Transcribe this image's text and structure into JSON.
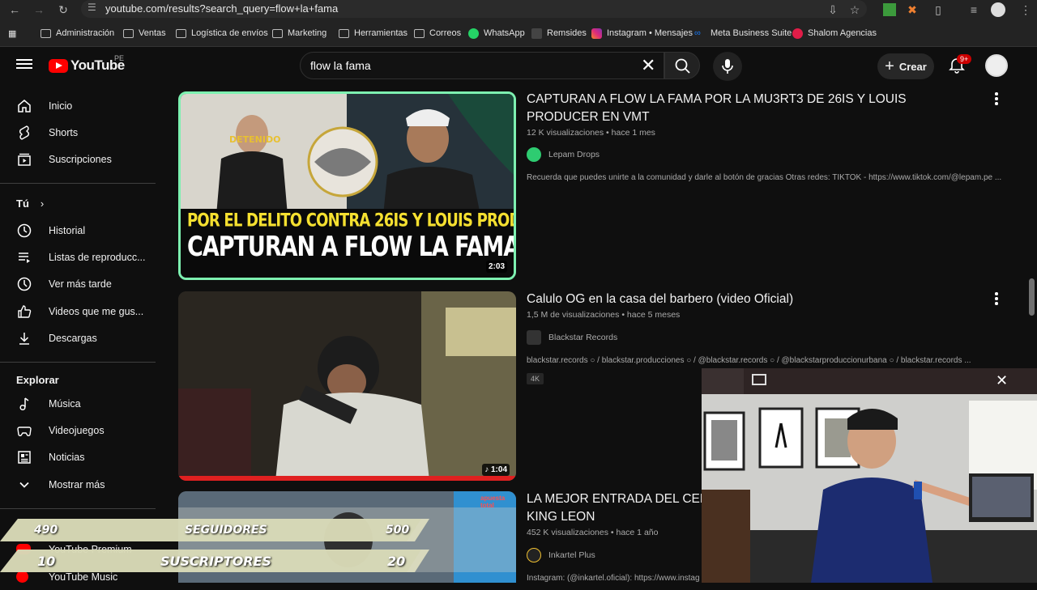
{
  "browser": {
    "url": "youtube.com/results?search_query=flow+la+fama",
    "bookmarks": [
      "Administración",
      "Ventas",
      "Logística de envíos",
      "Marketing",
      "Herramientas",
      "Correos",
      "WhatsApp",
      "Remsides",
      "Instagram • Mensajes",
      "Meta Business Suite",
      "Shalom Agencias"
    ]
  },
  "header": {
    "logo_text": "YouTube",
    "country_code": "PE",
    "search_value": "flow la fama",
    "create_label": "Crear",
    "notifications_badge": "9+"
  },
  "sidebar": {
    "main": [
      "Inicio",
      "Shorts",
      "Suscripciones"
    ],
    "you_section": "Tú",
    "you_items": [
      "Historial",
      "Listas de reproducc...",
      "Ver más tarde",
      "Videos que me gus...",
      "Descargas"
    ],
    "explore_section": "Explorar",
    "explore_items": [
      "Música",
      "Videojuegos",
      "Noticias",
      "Mostrar más"
    ],
    "more_items": [
      "YouTube Premium",
      "YouTube Music"
    ]
  },
  "results": [
    {
      "title": "CAPTURAN A FLOW LA FAMA POR LA MU3RT3 DE 26IS Y LOUIS PRODUCER EN VMT",
      "views": "12 K visualizaciones",
      "age": "hace 1 mes",
      "channel": "Lepam Drops",
      "description": "Recuerda que puedes unirte a la comunidad y darle al botón de gracias Otras redes: TIKTOK - https://www.tiktok.com/@lepam.pe ...",
      "duration": "2:03",
      "thumb_line1": "POR EL DELITO CONTRA 26IS Y LOUIS PRODUCER",
      "thumb_line2": "CAPTURAN A FLOW LA FAMA",
      "thumb_shirt": "DETENIDO"
    },
    {
      "title": "Calulo OG en la casa del barbero (video Oficial)",
      "views": "1,5 M de visualizaciones",
      "age": "hace 5 meses",
      "channel": "Blackstar Records",
      "description": "blackstar.records ○ / blackstar.producciones ○ / @blackstar.records ○ / @blackstarproduccionurbana ○ / blackstar.records ...",
      "duration": "1:04",
      "badge": "4K"
    },
    {
      "title": "LA MEJOR ENTRADA DEL CELEB",
      "title_line2": "KING LEON",
      "views": "452 K visualizaciones",
      "age": "hace 1 año",
      "channel": "Inkartel Plus",
      "description": "Instagram: (@inkartel.oficial): https://www.instag",
      "thumb_tag": "apuesta total"
    }
  ],
  "stream_overlay": {
    "followers_current": "490",
    "followers_label": "SEGUIDORES",
    "followers_goal": "500",
    "subs_current": "10",
    "subs_label": "SUSCRIPTORES",
    "subs_goal": "20"
  },
  "colors": {
    "accent": "#ff0000",
    "background": "#0f0f0f",
    "text_secondary": "#aaaaaa",
    "thumb1_border": "#7df0b0"
  }
}
